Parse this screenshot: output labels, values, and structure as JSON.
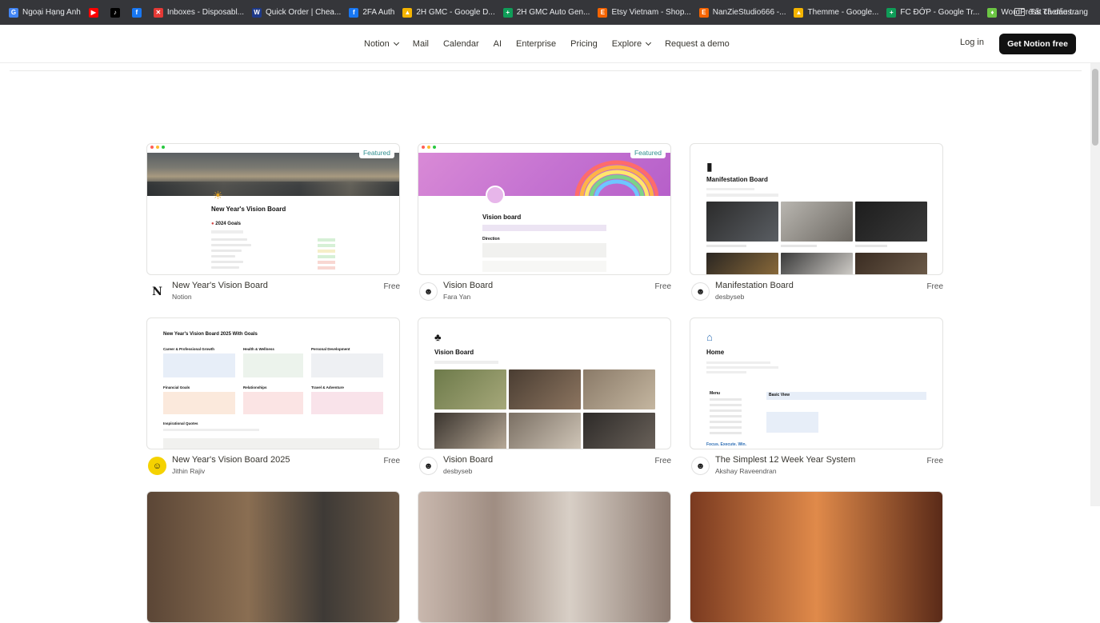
{
  "bookmarks": [
    {
      "label": "Ngoại Hạng Anh",
      "color": "#4285f4",
      "glyph": "G"
    },
    {
      "label": "",
      "color": "#ff0000",
      "glyph": "▶"
    },
    {
      "label": "",
      "color": "#000000",
      "glyph": "♪"
    },
    {
      "label": "",
      "color": "#1877f2",
      "glyph": "f"
    },
    {
      "label": "Inboxes - Disposabl...",
      "color": "#e53935",
      "glyph": "✕"
    },
    {
      "label": "Quick Order | Chea...",
      "color": "#1e3a8a",
      "glyph": "W"
    },
    {
      "label": "2FA Auth",
      "color": "#1877f2",
      "glyph": "f"
    },
    {
      "label": "2H GMC - Google D...",
      "color": "#f4b400",
      "glyph": "▲"
    },
    {
      "label": "2H GMC Auto Gen...",
      "color": "#0f9d58",
      "glyph": "+"
    },
    {
      "label": "Etsy Vietnam - Shop...",
      "color": "#f56400",
      "glyph": "E"
    },
    {
      "label": "NanZieStudio666 -...",
      "color": "#f56400",
      "glyph": "E"
    },
    {
      "label": "Themme - Google...",
      "color": "#f4b400",
      "glyph": "▲"
    },
    {
      "label": "FC ĐỚP - Google Tr...",
      "color": "#0f9d58",
      "glyph": "+"
    },
    {
      "label": "WordPress Themes...",
      "color": "#6cc644",
      "glyph": "♦"
    }
  ],
  "all_bookmarks_label": "Tất cả dấu trang",
  "nav": {
    "links": [
      "Notion",
      "Mail",
      "Calendar",
      "AI",
      "Enterprise",
      "Pricing",
      "Explore",
      "Request a demo"
    ],
    "login": "Log in",
    "cta": "Get Notion free"
  },
  "featured_label": "Featured",
  "cards": [
    {
      "title": "New Year's Vision Board",
      "author": "Notion",
      "price": "Free"
    },
    {
      "title": "Vision Board",
      "author": "Fara Yan",
      "price": "Free"
    },
    {
      "title": "Manifestation Board",
      "author": "desbyseb",
      "price": "Free"
    },
    {
      "title": "New Year's Vision Board 2025",
      "author": "Jithin Rajiv",
      "price": "Free"
    },
    {
      "title": "Vision Board",
      "author": "desbyseb",
      "price": "Free"
    },
    {
      "title": "The Simplest 12 Week Year System",
      "author": "Akshay Raveendran",
      "price": "Free"
    }
  ],
  "previews": {
    "p1_title": "New Year's Vision Board",
    "p1_sub": "2024 Goals",
    "p2_title": "Vision board",
    "p2_sub": "Direction",
    "p3_title": "Manifestation Board",
    "p4_title": "New Year's Vision Board 2025 With Goals",
    "p4_cols": [
      "Career & Professional Growth",
      "Health & Wellness",
      "Personal Development"
    ],
    "p4_cols2": [
      "Financial Goals",
      "Relationships",
      "Travel & Adventure"
    ],
    "p4_quotes": "Inspirational Quotes",
    "p5_title": "Vision Board",
    "p6_title": "Home",
    "p6_menu": "Menu",
    "p6_basic": "Basic View",
    "p6_footer": "Focus. Execute. Win."
  }
}
